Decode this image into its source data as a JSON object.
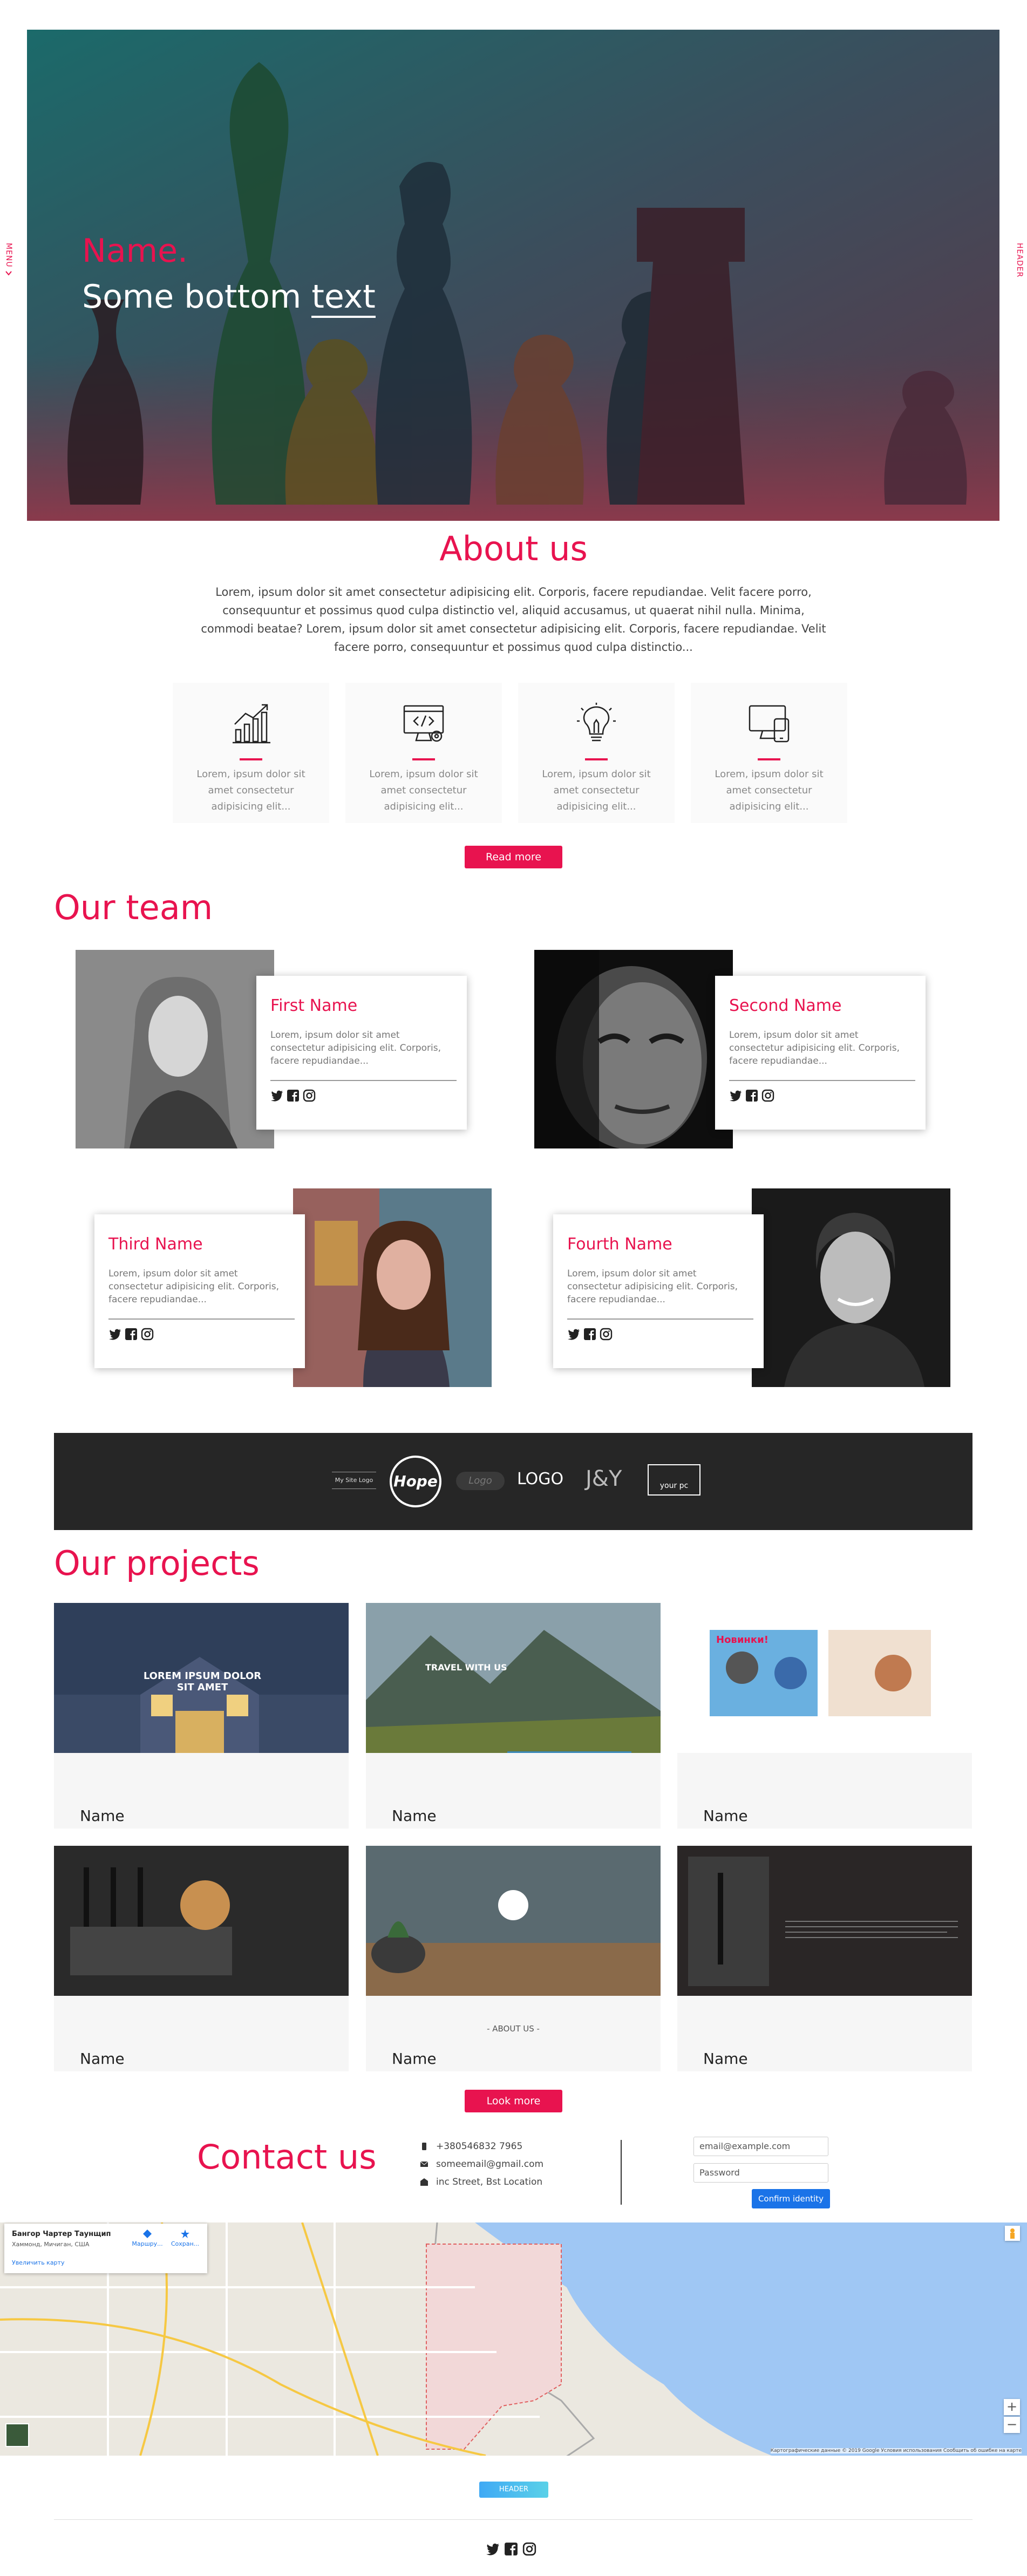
{
  "side": {
    "left": "MENU",
    "right": "HEADER"
  },
  "hero": {
    "name": "Name.",
    "sub_prefix": "Some bottom ",
    "sub_underlined": "text"
  },
  "about": {
    "title": "About us",
    "text": "Lorem, ipsum dolor sit amet consectetur adipisicing elit. Corporis, facere repudiandae. Velit facere porro, consequuntur et possimus quod culpa distinctio vel, aliquid accusamus, ut quaerat nihil nulla. Minima, commodi beatae? Lorem, ipsum dolor sit amet consectetur adipisicing elit. Corporis, facere repudiandae. Velit facere porro, consequuntur et possimus quod culpa distinctio...",
    "cards": [
      {
        "icon": "growth-chart-icon",
        "text": "Lorem, ipsum dolor sit amet consectetur adipisicing elit..."
      },
      {
        "icon": "code-monitor-icon",
        "text": "Lorem, ipsum dolor sit amet consectetur adipisicing elit..."
      },
      {
        "icon": "lightbulb-icon",
        "text": "Lorem, ipsum dolor sit amet consectetur adipisicing elit..."
      },
      {
        "icon": "devices-icon",
        "text": "Lorem, ipsum dolor sit amet consectetur adipisicing elit..."
      }
    ],
    "button": "Read more"
  },
  "team": {
    "title": "Our team",
    "members": [
      {
        "name": "First Name",
        "text": "Lorem, ipsum dolor sit amet consectetur adipisicing elit. Corporis, facere repudiandae..."
      },
      {
        "name": "Second Name",
        "text": "Lorem, ipsum dolor sit amet consectetur adipisicing elit. Corporis, facere repudiandae..."
      },
      {
        "name": "Third Name",
        "text": "Lorem, ipsum dolor sit amet consectetur adipisicing elit. Corporis, facere repudiandae..."
      },
      {
        "name": "Fourth Name",
        "text": "Lorem, ipsum dolor sit amet consectetur adipisicing elit. Corporis, facere repudiandae..."
      }
    ]
  },
  "logos": [
    "My Site Logo",
    "Hope",
    "Logo",
    "LOGO",
    "J&Y",
    "your pc"
  ],
  "projects": {
    "title": "Our projects",
    "items": [
      {
        "name": "Name",
        "caption": "LOREM IPSUM DOLOR SIT AMET"
      },
      {
        "name": "Name",
        "caption": "TRAVEL WITH US"
      },
      {
        "name": "Name",
        "caption": "Новинки!"
      },
      {
        "name": "Name",
        "caption": ""
      },
      {
        "name": "Name",
        "caption": "- ABOUT US -"
      },
      {
        "name": "Name",
        "caption": ""
      }
    ],
    "button": "Look more"
  },
  "contact": {
    "title": "Contact us",
    "phone": "+380546832 7965",
    "email": "someemail@gmail.com",
    "address": "inc Street, Bst Location",
    "email_placeholder": "email@example.com",
    "password_placeholder": "Password",
    "submit": "Confirm identity"
  },
  "map": {
    "place_title": "Бангор Чартер Таунщип",
    "place_sub": "Хаммонд, Мичиган, США",
    "directions": "Маршру...",
    "save": "Сохран...",
    "enlarge": "Увеличить карту",
    "credits": "Картографические данные © 2019 Google   Условия использования   Сообщить об ошибке на карте"
  },
  "footer": {
    "button": "HEADER"
  },
  "colors": {
    "accent": "#e8134f",
    "blue": "#1a73e8"
  }
}
